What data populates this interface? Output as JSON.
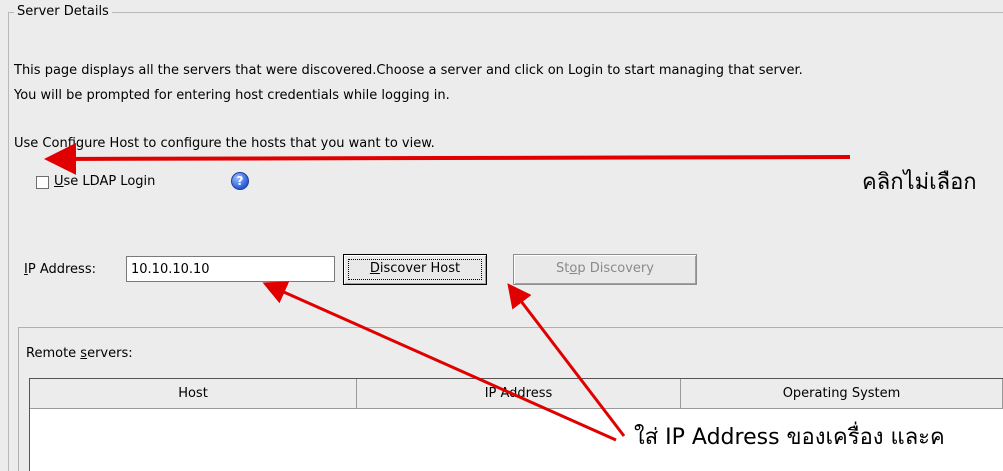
{
  "group": {
    "title": "Server Details"
  },
  "description": {
    "line1": "This page displays all the servers that were discovered.Choose a server and click on Login to start managing that server.",
    "line2": "You will be prompted for entering host credentials while logging in.",
    "line3": "Use Configure Host to configure the hosts that you want to view."
  },
  "ldap": {
    "label_rest": "se LDAP Login",
    "label_mnemonic": "U",
    "checked": false,
    "help_icon": "help-icon"
  },
  "ip": {
    "label_mnemonic": "I",
    "label_rest": "P Address:",
    "value": "10.10.10.10"
  },
  "buttons": {
    "discover_mnemonic": "D",
    "discover_rest": "iscover Host",
    "stop_pre": "St",
    "stop_mnemonic": "o",
    "stop_post": "p Discovery"
  },
  "remote": {
    "label_pre": "Remote ",
    "label_mnemonic": "s",
    "label_post": "ervers:",
    "columns": [
      "Host",
      "IP Address",
      "Operating System"
    ]
  },
  "annotations": {
    "click_uncheck": "คลิกไม่เลือก",
    "enter_ip": "ใส่ IP Address ของเครื่อง และค"
  },
  "colors": {
    "arrow": "#e00000",
    "help": "#2a5bd8"
  }
}
